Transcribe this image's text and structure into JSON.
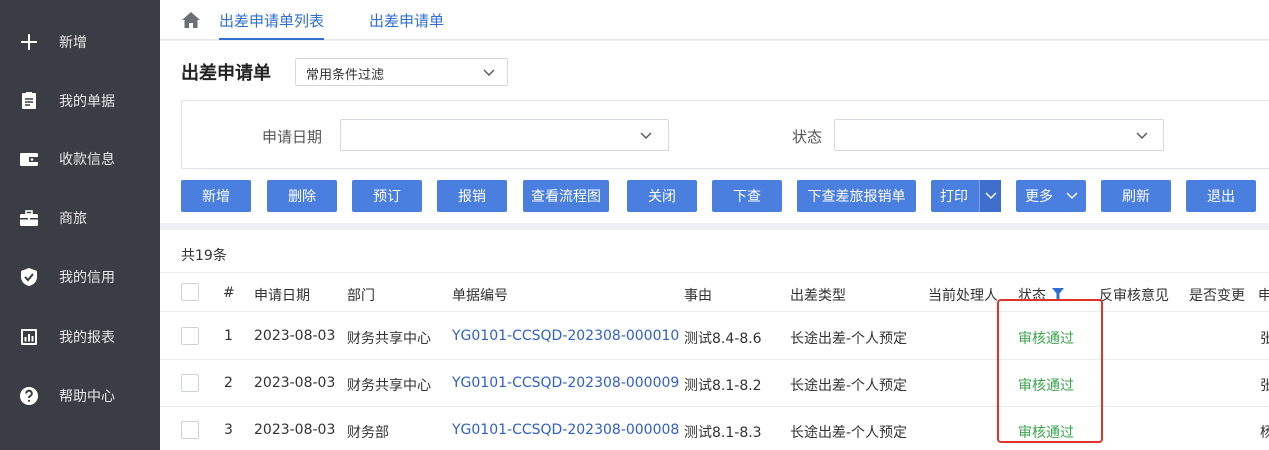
{
  "sidebar": {
    "items": [
      {
        "label": "新增",
        "icon": "plus-icon"
      },
      {
        "label": "我的单据",
        "icon": "document-icon"
      },
      {
        "label": "收款信息",
        "icon": "wallet-icon"
      },
      {
        "label": "商旅",
        "icon": "briefcase-icon"
      },
      {
        "label": "我的信用",
        "icon": "shield-check-icon"
      },
      {
        "label": "我的报表",
        "icon": "report-icon"
      },
      {
        "label": "帮助中心",
        "icon": "help-icon"
      }
    ]
  },
  "tabs": [
    {
      "label": "出差申请单列表",
      "active": true
    },
    {
      "label": "出差申请单",
      "active": false
    }
  ],
  "header": {
    "title": "出差申请单",
    "filter_value": "常用条件过滤"
  },
  "search": {
    "date_label": "申请日期",
    "date_value": "",
    "status_label": "状态",
    "status_value": ""
  },
  "toolbar": {
    "buttons": [
      "新增",
      "删除",
      "预订",
      "报销",
      "查看流程图",
      "关闭",
      "下查",
      "下查差旅报销单",
      "打印",
      "更多",
      "刷新",
      "退出"
    ]
  },
  "table": {
    "count_text": "共19条",
    "columns": [
      "#",
      "申请日期",
      "部门",
      "单据编号",
      "事由",
      "出差类型",
      "当前处理人",
      "状态",
      "反审核意见",
      "是否变更",
      "申"
    ],
    "rows": [
      {
        "index": "1",
        "date": "2023-08-03",
        "dept": "财务共享中心",
        "doc_no": "YG0101-CCSQD-202308-000010",
        "reason": "测试8.4-8.6",
        "type": "长途出差-个人预定",
        "handler": "",
        "status": "审核通过",
        "trail": "张"
      },
      {
        "index": "2",
        "date": "2023-08-03",
        "dept": "财务共享中心",
        "doc_no": "YG0101-CCSQD-202308-000009",
        "reason": "测试8.1-8.2",
        "type": "长途出差-个人预定",
        "handler": "",
        "status": "审核通过",
        "trail": "张"
      },
      {
        "index": "3",
        "date": "2023-08-03",
        "dept": "财务部",
        "doc_no": "YG0101-CCSQD-202308-000008",
        "reason": "测试8.1-8.3",
        "type": "长途出差-个人预定",
        "handler": "",
        "status": "审核通过",
        "trail": "杨"
      }
    ]
  },
  "colors": {
    "sidebar_bg": "#3a3d44",
    "primary": "#4a7fdf",
    "link": "#2f5fc9",
    "success": "#3aa64b",
    "highlight": "#e0332a"
  }
}
